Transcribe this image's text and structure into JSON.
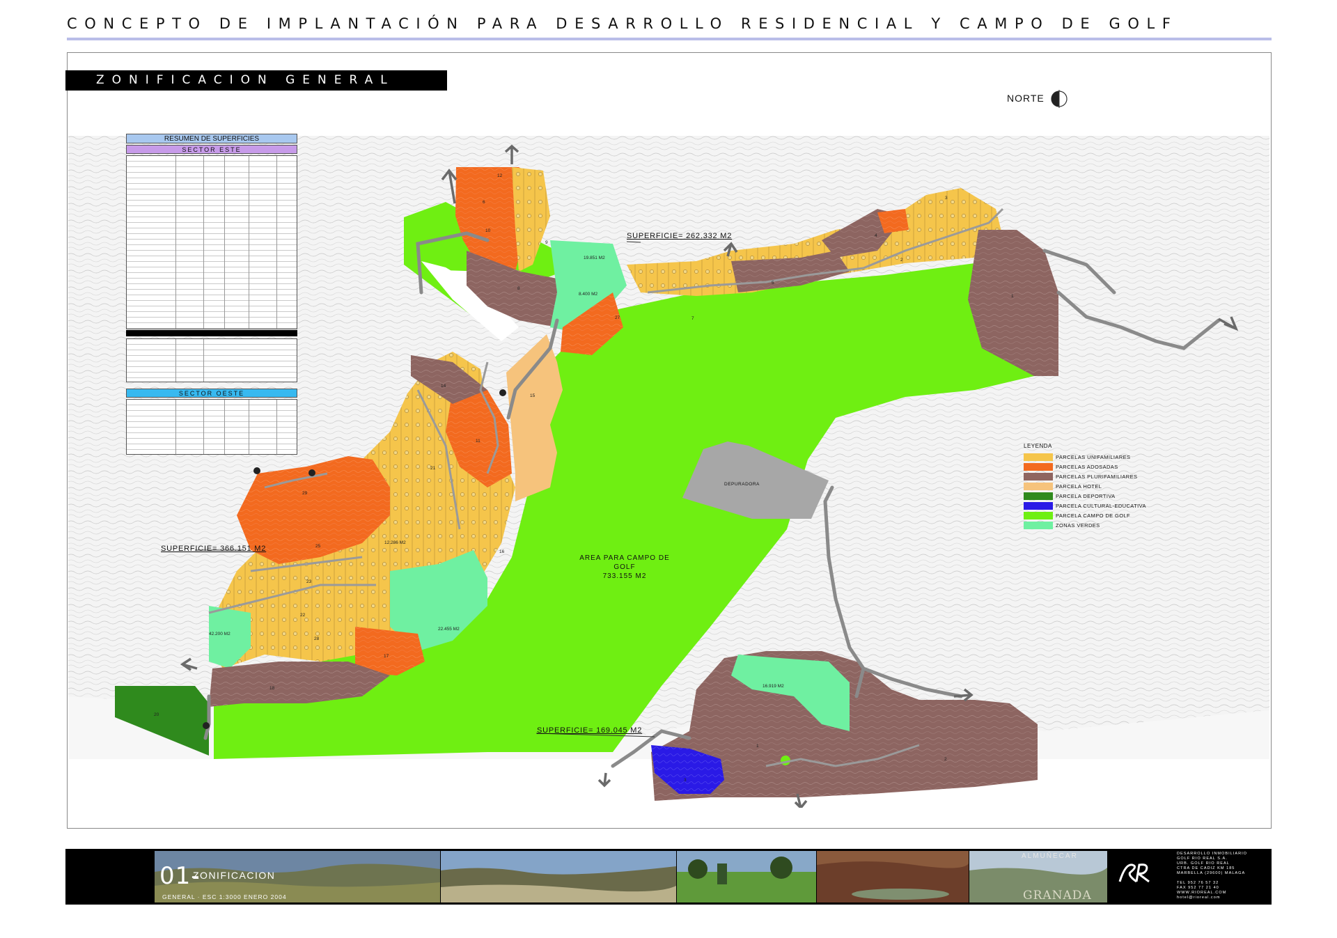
{
  "header": {
    "title": "CONCEPTO DE IMPLANTACIÓN PARA DESARROLLO RESIDENCIAL Y CAMPO DE GOLF",
    "section": "ZONIFICACION GENERAL",
    "north": "NORTE"
  },
  "summary": {
    "title": "RESUMEN DE SUPERFICIES",
    "sector_east": "SECTOR ESTE",
    "sector_west": "SECTOR OESTE"
  },
  "map": {
    "superficie_north": "SUPERFICIE= 262.332 M2",
    "superficie_west": "SUPERFICIE= 366.151 M2",
    "superficie_south": "SUPERFICIE= 169.045 M2",
    "golf_area_line1": "AREA PARA CAMPO DE GOLF",
    "golf_area_line2": "733.155 M2",
    "depuradora": "DEPURADORA",
    "zone_values": [
      "19.851 M2",
      "8.400 M2",
      "12.286 M2",
      "22.455 M2",
      "42.200 M2",
      "16.919 M2"
    ],
    "plot_numbers": [
      "12",
      "6",
      "10",
      "9",
      "8",
      "3",
      "5",
      "1",
      "2",
      "4",
      "7",
      "27",
      "14",
      "15",
      "11",
      "29",
      "25",
      "23",
      "22",
      "28",
      "21",
      "16",
      "17",
      "18",
      "20",
      "1",
      "2",
      "3"
    ]
  },
  "legend": {
    "title": "LEYENDA",
    "items": [
      {
        "label": "PARCELAS UNIFAMILIARES",
        "color": "#f5c54b"
      },
      {
        "label": "PARCELAS ADOSADAS",
        "color": "#f36a1f"
      },
      {
        "label": "PARCELAS PLURIFAMILIARES",
        "color": "#8f6560"
      },
      {
        "label": "PARCELA HOTEL",
        "color": "#f6c37c"
      },
      {
        "label": "PARCELA DEPORTIVA",
        "color": "#2f8a1d"
      },
      {
        "label": "PARCELA CULTURAL-EDUCATIVA",
        "color": "#2a1ae6"
      },
      {
        "label": "PARCELA CAMPO DE GOLF",
        "color": "#6fef12"
      },
      {
        "label": "ZONAS VERDES",
        "color": "#6ff0a1"
      }
    ]
  },
  "footer": {
    "sheet_number": "01-",
    "sheet_name": "ZONIFICACION",
    "sheet_sub": "GENERAL · ESC 1:3000 ENERO 2004",
    "place1": "ALMUÑECAR",
    "place2": "GRANADA",
    "company": [
      "DESARROLLO INMOBILIARIO",
      "GOLF RIO REAL S.A.",
      "URB. GOLF RIO REAL",
      "CTRA DE CADIZ KM 185",
      "MARBELLA (29600) MALAGA",
      "",
      "TEL 952 76 57 32",
      "FAX 952 77 21 40",
      "WWW.RIOREAL.COM",
      "hotel@rioreal.com"
    ]
  }
}
